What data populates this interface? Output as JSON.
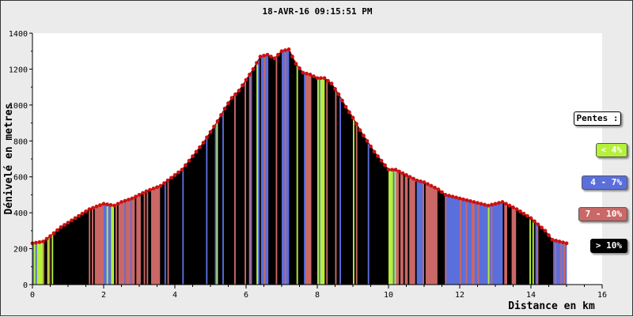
{
  "chart_data": {
    "type": "area",
    "title": "18-AVR-16 09:15:51 PM",
    "xlabel": "Distance en km",
    "ylabel": "Dénivelé en metres",
    "xlim": [
      0,
      16
    ],
    "ylim": [
      0,
      1400
    ],
    "x_ticks": [
      0,
      2,
      4,
      6,
      8,
      10,
      12,
      14,
      16
    ],
    "y_ticks": [
      0,
      200,
      400,
      600,
      800,
      1000,
      1200,
      1400
    ],
    "grid": false,
    "profile": {
      "x": [
        0.0,
        0.3,
        0.5,
        0.8,
        1.2,
        1.6,
        2.0,
        2.3,
        2.5,
        2.8,
        3.2,
        3.6,
        3.8,
        4.0,
        4.2,
        4.4,
        4.6,
        4.8,
        5.0,
        5.2,
        5.4,
        5.6,
        5.8,
        6.0,
        6.2,
        6.4,
        6.6,
        6.8,
        7.0,
        7.2,
        7.4,
        7.6,
        7.8,
        8.0,
        8.2,
        8.4,
        8.6,
        8.8,
        9.0,
        9.2,
        9.4,
        9.6,
        9.8,
        10.0,
        10.2,
        10.4,
        10.6,
        10.8,
        11.0,
        11.2,
        11.4,
        11.6,
        11.8,
        12.0,
        12.4,
        12.8,
        13.2,
        13.6,
        14.0,
        14.4,
        14.6,
        14.8,
        15.0
      ],
      "y": [
        230,
        240,
        270,
        320,
        370,
        420,
        450,
        440,
        460,
        480,
        520,
        550,
        580,
        610,
        640,
        690,
        740,
        790,
        850,
        910,
        980,
        1040,
        1080,
        1140,
        1200,
        1270,
        1280,
        1260,
        1300,
        1310,
        1230,
        1180,
        1170,
        1150,
        1150,
        1120,
        1060,
        990,
        930,
        860,
        800,
        740,
        690,
        640,
        640,
        620,
        600,
        580,
        570,
        550,
        530,
        500,
        490,
        480,
        460,
        440,
        460,
        420,
        370,
        300,
        250,
        240,
        230
      ]
    },
    "legend": {
      "title": "Pentes :",
      "entries": [
        {
          "label": "< 4%",
          "color": "#b5f03a",
          "text_color": "#ffffff"
        },
        {
          "label": "4 - 7%",
          "color": "#5b6fdc",
          "text_color": "#ffffff"
        },
        {
          "label": "7 - 10%",
          "color": "#c96866",
          "text_color": "#ffffff"
        },
        {
          "label": "> 10%",
          "color": "#000000",
          "text_color": "#ffffff"
        }
      ]
    },
    "marker_color": "#cc1111"
  }
}
